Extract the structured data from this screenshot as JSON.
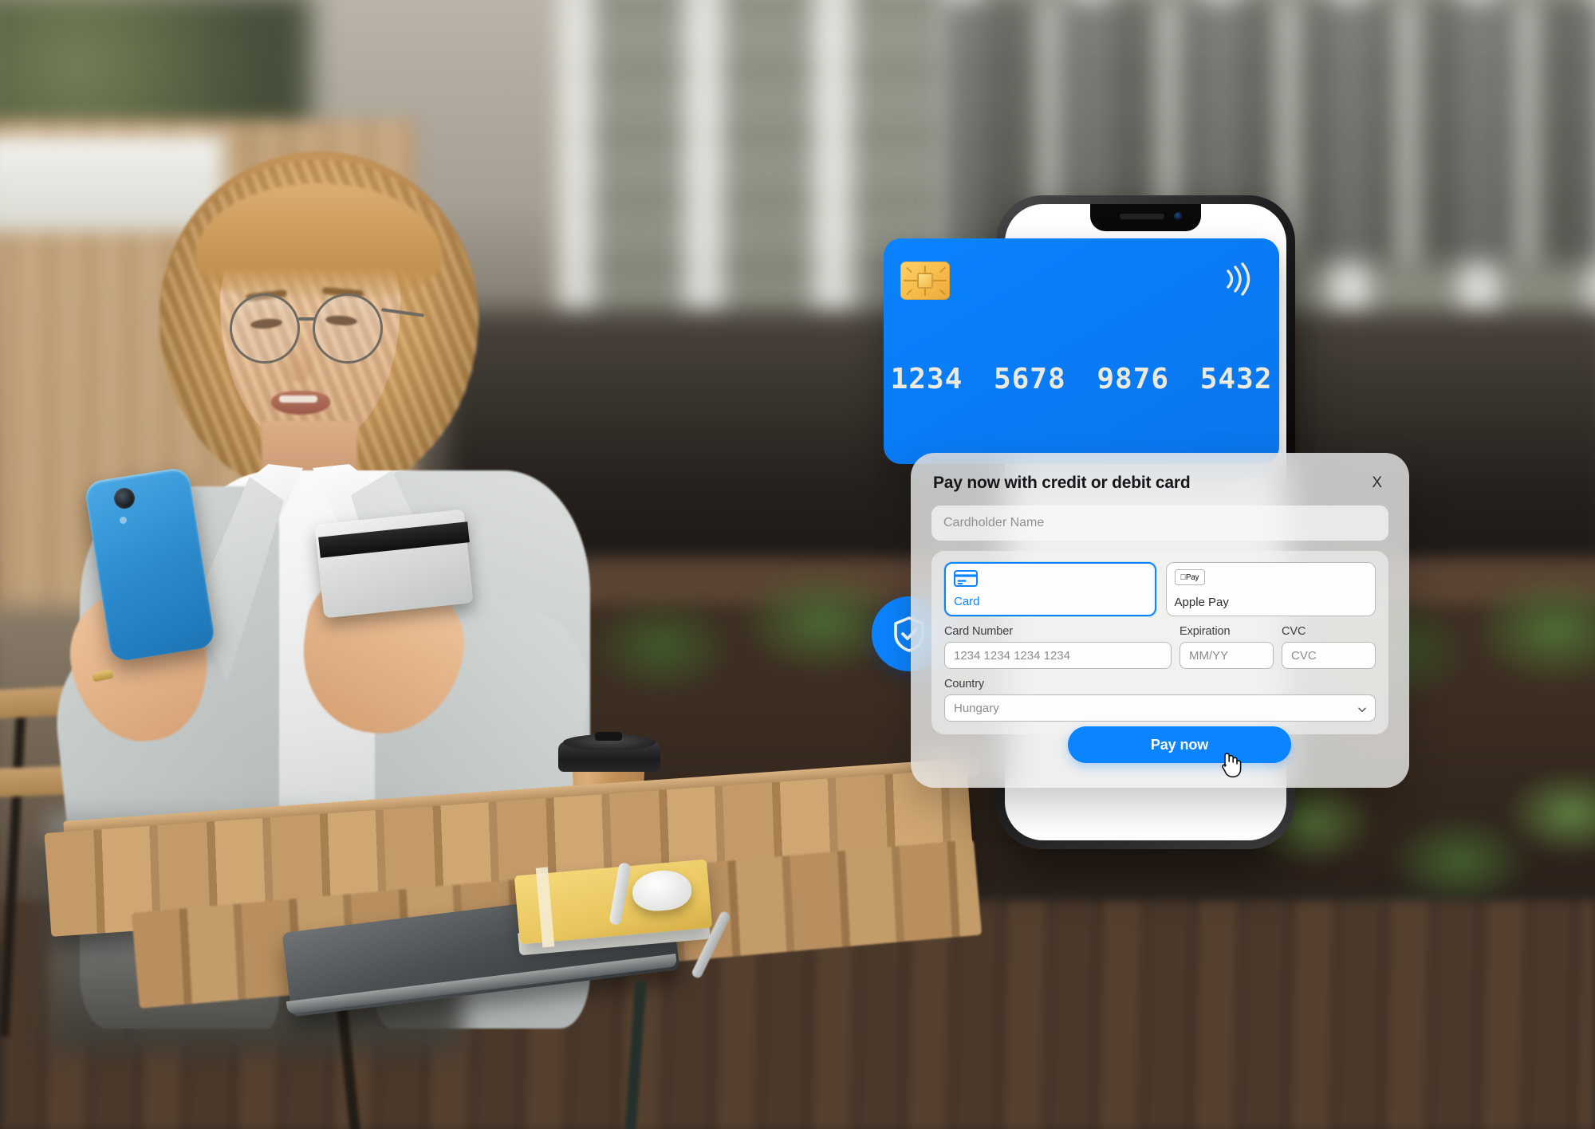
{
  "scene": {
    "description": "Woman at outdoor cafe table using phone and credit card",
    "subject": "woman-with-phone-and-card",
    "props": [
      "blue-smartphone",
      "silver-credit-card",
      "coffee-cup",
      "yellow-notebook",
      "airpods-case",
      "pen",
      "laptop",
      "wooden-table",
      "chair",
      "hedge",
      "glass-building"
    ]
  },
  "credit_card": {
    "number": "1234 5678 9876 5432",
    "chip_icon": "emv-chip-icon",
    "contactless_icon": "contactless-icon",
    "color": "#0b84ff"
  },
  "security_badge": {
    "icon": "shield-check-icon",
    "color": "#0b84ff"
  },
  "modal": {
    "title": "Pay now with credit or debit card",
    "close_label": "X",
    "cardholder": {
      "placeholder": "Cardholder Name",
      "value": ""
    },
    "methods": [
      {
        "label": "Card",
        "icon": "credit-card-icon",
        "selected": true
      },
      {
        "label": "Apple Pay",
        "icon": "apple-pay-icon",
        "badge": "Pay",
        "selected": false
      }
    ],
    "fields": [
      {
        "label": "Card Number",
        "placeholder": "1234 1234 1234 1234",
        "value": ""
      },
      {
        "label": "Expiration",
        "placeholder": "MM/YY",
        "value": ""
      },
      {
        "label": "CVC",
        "placeholder": "CVC",
        "value": ""
      }
    ],
    "country": {
      "label": "Country",
      "selected": "Hungary",
      "chevron_icon": "chevron-down-icon"
    },
    "submit_label": "Pay now",
    "accent_color": "#0b84ff"
  },
  "cursor": {
    "type": "pointing-hand-cursor"
  }
}
